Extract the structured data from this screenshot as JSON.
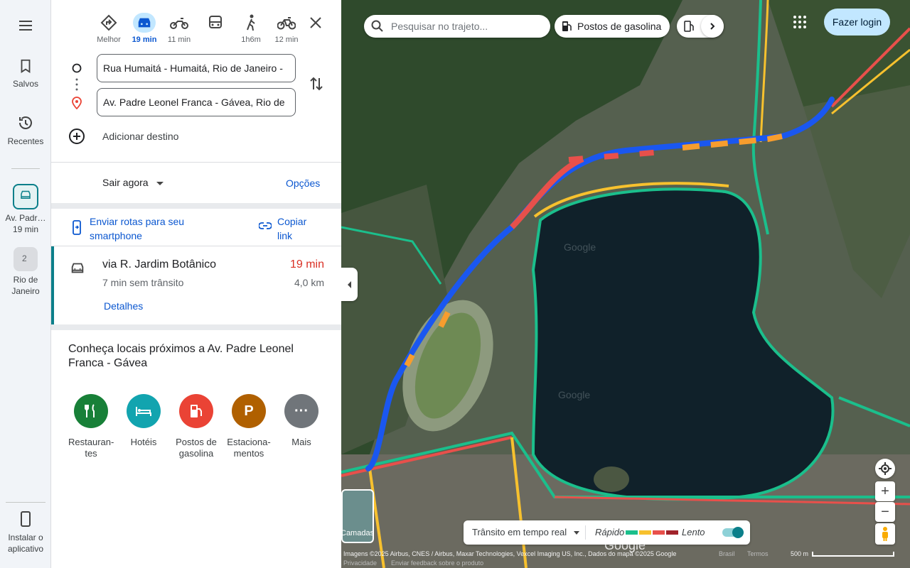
{
  "rail": {
    "menu_icon": "menu-icon",
    "saved": "Salvos",
    "recent": "Recentes",
    "current_place": "Av. Padr…",
    "current_time": "19 min",
    "rio_line1": "Rio de",
    "rio_line2": "Janeiro",
    "rio_badge": "2",
    "install_line1": "Instalar o",
    "install_line2": "aplicativo"
  },
  "modes": [
    {
      "label": "Melhor",
      "icon": "best-route-icon"
    },
    {
      "label": "19 min",
      "icon": "car-icon"
    },
    {
      "label": "11 min",
      "icon": "motorcycle-icon"
    },
    {
      "label": "",
      "icon": "bus-icon"
    },
    {
      "label": "1h6m",
      "icon": "walk-icon"
    },
    {
      "label": "12 min",
      "icon": "bike-icon"
    }
  ],
  "route": {
    "origin": "Rua Humaitá - Humaitá, Rio de Janeiro - ",
    "destination": "Av. Padre Leonel Franca - Gávea, Rio de",
    "add_destination": "Adicionar destino",
    "depart": "Sair agora",
    "options": "Opções",
    "send_line1": "Enviar rotas para seu",
    "send_line2": "smartphone",
    "copy_line1": "Copiar",
    "copy_line2": "link"
  },
  "result": {
    "via": "via R. Jardim Botânico",
    "time": "19 min",
    "no_traffic": "7 min sem trânsito",
    "distance": "4,0 km",
    "details": "Detalhes"
  },
  "nearby": {
    "title": "Conheça locais próximos a Av. Padre Leonel Franca - Gávea",
    "categories": [
      {
        "label_a": "Restauran-",
        "label_b": "tes",
        "color": "#188038"
      },
      {
        "label_a": "Hotéis",
        "label_b": "",
        "color": "#12a4af"
      },
      {
        "label_a": "Postos de",
        "label_b": "gasolina",
        "color": "#ea4335"
      },
      {
        "label_a": "Estaciona-",
        "label_b": "mentos",
        "color": "#b06000"
      },
      {
        "label_a": "Mais",
        "label_b": "",
        "color": "#70757a"
      }
    ]
  },
  "map": {
    "search_placeholder": "Pesquisar no trajeto...",
    "gas_chip": "Postos de gasolina",
    "login": "Fazer login",
    "layers": "Camadas",
    "traffic": "Trânsito em tempo real",
    "fast": "Rápido",
    "slow": "Lento",
    "attribution": "Imagens ©2025 Airbus, CNES / Airbus, Maxar Technologies, Vexcel Imaging US, Inc., Dados do mapa ©2025 Google",
    "country": "Brasil",
    "terms": "Termos",
    "scale": "500 m",
    "privacy": "Privacidade",
    "feedback": "Enviar feedback sobre o produto",
    "watermark": "Google",
    "colors": {
      "fast": "#1bbf8c",
      "medium": "#f7c12e",
      "slowish": "#e8504b",
      "slow": "#a1232b",
      "route": "#1a57f0"
    }
  }
}
